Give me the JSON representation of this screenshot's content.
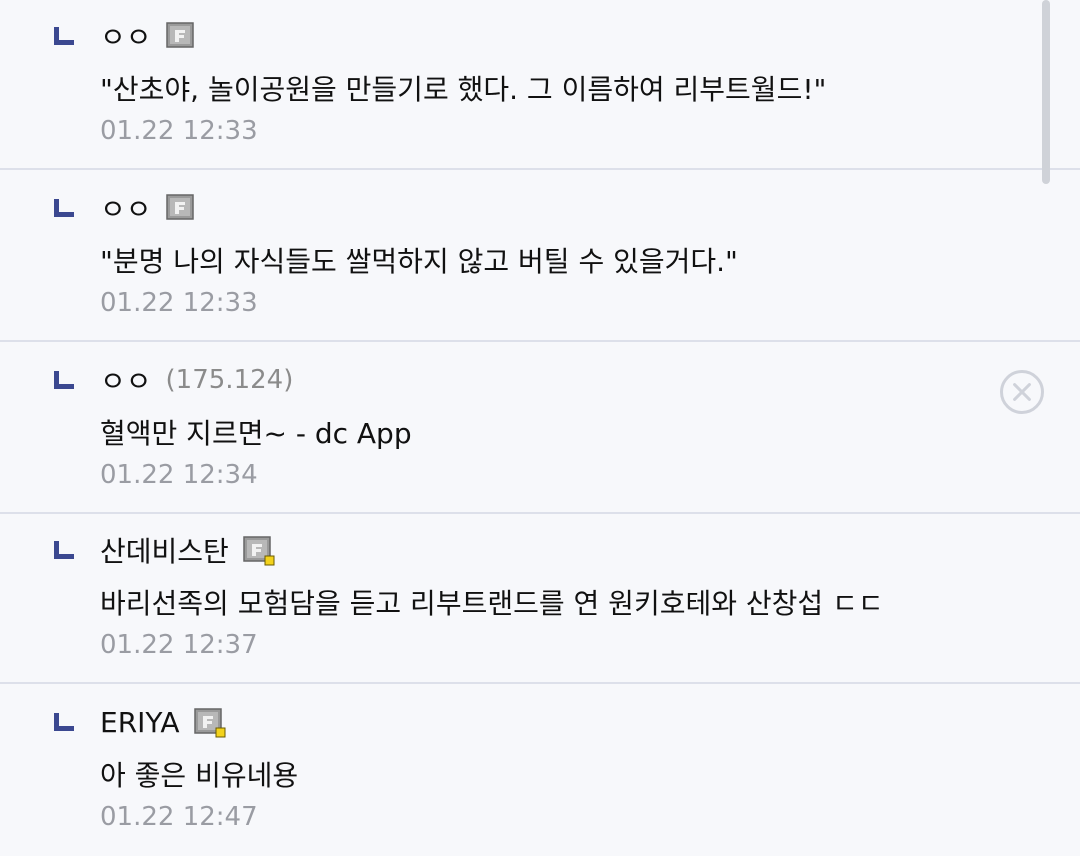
{
  "comments": [
    {
      "nick": "ㅇㅇ",
      "ip": "",
      "text": "\"산초야, 놀이공원을 만들기로 했다. 그 이름하여 리부트월드!\"",
      "date": "01.22 12:33",
      "badge": "fixed-nick-icon"
    },
    {
      "nick": "ㅇㅇ",
      "ip": "",
      "text": "\"분명 나의 자식들도 쌀먹하지 않고 버틸 수 있을거다.\"",
      "date": "01.22 12:33",
      "badge": "fixed-nick-icon"
    },
    {
      "nick": "ㅇㅇ",
      "ip": "(175.124)",
      "text": "혈액만 지르면~ - dc App",
      "date": "01.22 12:34",
      "badge": ""
    },
    {
      "nick": "산데비스탄",
      "ip": "",
      "text": "바리선족의 모험담을 듣고 리부트랜드를 연 원키호테와 산창섭 ㄷㄷ",
      "date": "01.22 12:37",
      "badge": "semi-fixed-nick-icon"
    },
    {
      "nick": "ERIYA",
      "ip": "",
      "text": "아 좋은 비유네용",
      "date": "01.22 12:47",
      "badge": "semi-fixed-nick-icon"
    }
  ],
  "colors": {
    "reply_mark": "#3b4890",
    "date": "#9a9ca3",
    "divider": "#dde0ea",
    "background": "#f7f8fb"
  }
}
